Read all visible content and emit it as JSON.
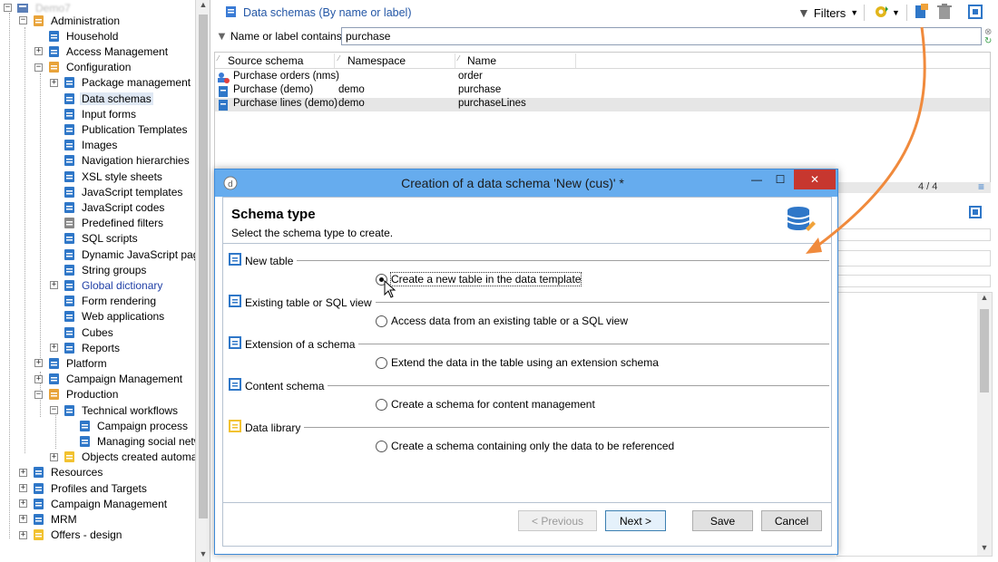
{
  "tree": {
    "root_label": "Demo7",
    "items": [
      {
        "label": "Administration",
        "icon": "wrench-icon",
        "exp": "-"
      },
      {
        "label": "Household",
        "icon": "grid-icon",
        "exp": ""
      },
      {
        "label": "Access Management",
        "icon": "users-icon",
        "exp": "+"
      },
      {
        "label": "Configuration",
        "icon": "gear-icon",
        "exp": "-"
      },
      {
        "label": "Package management",
        "icon": "package-icon",
        "exp": "+"
      },
      {
        "label": "Data schemas",
        "icon": "schema-icon",
        "exp": ""
      },
      {
        "label": "Input forms",
        "icon": "form-icon",
        "exp": ""
      },
      {
        "label": "Publication Templates",
        "icon": "template-icon",
        "exp": ""
      },
      {
        "label": "Images",
        "icon": "image-icon",
        "exp": ""
      },
      {
        "label": "Navigation hierarchies",
        "icon": "hierarchy-icon",
        "exp": ""
      },
      {
        "label": "XSL style sheets",
        "icon": "xsl-icon",
        "exp": ""
      },
      {
        "label": "JavaScript templates",
        "icon": "js-template-icon",
        "exp": ""
      },
      {
        "label": "JavaScript codes",
        "icon": "js-code-icon",
        "exp": ""
      },
      {
        "label": "Predefined filters",
        "icon": "filter-icon",
        "exp": ""
      },
      {
        "label": "SQL scripts",
        "icon": "sql-icon",
        "exp": ""
      },
      {
        "label": "Dynamic JavaScript page",
        "icon": "js-page-icon",
        "exp": ""
      },
      {
        "label": "String groups",
        "icon": "string-icon",
        "exp": ""
      },
      {
        "label": "Global dictionary",
        "icon": "dictionary-icon",
        "exp": "+"
      },
      {
        "label": "Form rendering",
        "icon": "form-render-icon",
        "exp": ""
      },
      {
        "label": "Web applications",
        "icon": "web-app-icon",
        "exp": ""
      },
      {
        "label": "Cubes",
        "icon": "cube-icon",
        "exp": ""
      },
      {
        "label": "Reports",
        "icon": "report-icon",
        "exp": "+"
      },
      {
        "label": "Platform",
        "icon": "platform-icon",
        "exp": "+"
      },
      {
        "label": "Campaign Management",
        "icon": "campaign-icon",
        "exp": "+"
      },
      {
        "label": "Production",
        "icon": "production-icon",
        "exp": "-"
      },
      {
        "label": "Technical workflows",
        "icon": "workflow-icon",
        "exp": "-"
      },
      {
        "label": "Campaign process",
        "icon": "process-icon",
        "exp": ""
      },
      {
        "label": "Managing social netw",
        "icon": "process-icon",
        "exp": ""
      },
      {
        "label": "Objects created automat",
        "icon": "folder-icon",
        "exp": "+"
      },
      {
        "label": "Resources",
        "icon": "resources-icon",
        "exp": "+"
      },
      {
        "label": "Profiles and Targets",
        "icon": "profiles-icon",
        "exp": "+"
      },
      {
        "label": "Campaign Management",
        "icon": "campaign-icon",
        "exp": "+"
      },
      {
        "label": "MRM",
        "icon": "mrm-icon",
        "exp": "+"
      },
      {
        "label": "Offers - design",
        "icon": "offers-icon",
        "exp": "+"
      }
    ]
  },
  "main": {
    "title": "Data schemas (By name or label)",
    "filters_label": "Filters",
    "filter_label": "Name or label contains:",
    "filter_value": "purchase",
    "columns": [
      "Source schema",
      "Namespace",
      "Name"
    ],
    "rows": [
      {
        "source": "Purchase orders (nms)",
        "namespace": "",
        "name": "order"
      },
      {
        "source": "Purchase (demo)",
        "namespace": "demo",
        "name": "purchase"
      },
      {
        "source": "Purchase lines (demo)",
        "namespace": "demo",
        "name": "purchaseLines"
      }
    ],
    "count": "4 / 4"
  },
  "dialog": {
    "title": "Creation of a data schema 'New (cus)' *",
    "heading": "Schema type",
    "subheading": "Select the schema type to create.",
    "sections": [
      {
        "label": "New table",
        "icon": "new-table-icon",
        "option": "Create a new table in the data template",
        "selected": true
      },
      {
        "label": "Existing table or SQL view",
        "icon": "sql-view-icon",
        "option": "Access data from an existing table or a SQL view",
        "selected": false
      },
      {
        "label": "Extension of a schema",
        "icon": "extension-icon",
        "option": "Extend the data in the table using an extension schema",
        "selected": false
      },
      {
        "label": "Content schema",
        "icon": "content-icon",
        "option": "Create a schema for content management",
        "selected": false
      },
      {
        "label": "Data library",
        "icon": "library-icon",
        "option": "Create a schema containing only the data to be referenced",
        "selected": false
      }
    ],
    "buttons": {
      "previous": "< Previous",
      "next": "Next >",
      "save": "Save",
      "cancel": "Cancel"
    }
  },
  "colors": {
    "accent": "#66acee",
    "arrow": "#f08a3c",
    "title_blue": "#2457a6"
  }
}
